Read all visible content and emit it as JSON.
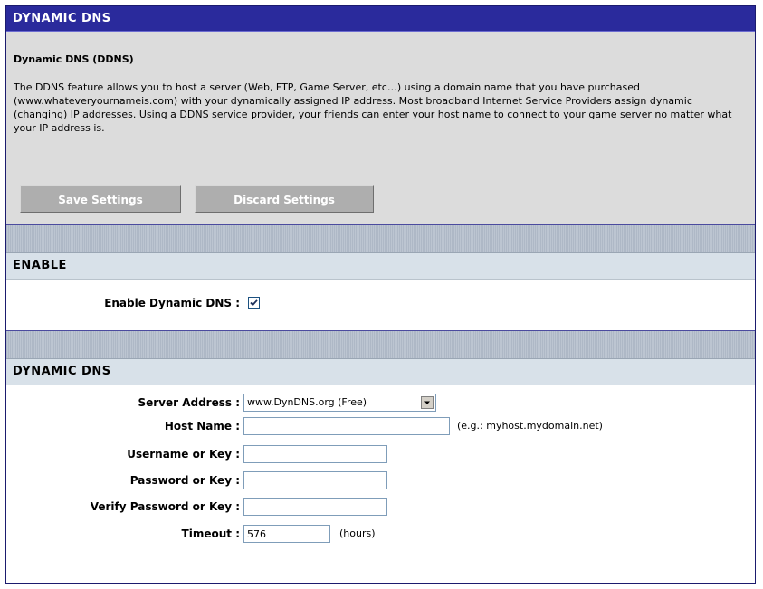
{
  "header": {
    "title": "DYNAMIC DNS"
  },
  "intro": {
    "title": "Dynamic DNS (DDNS)",
    "description": "The DDNS feature allows you to host a server (Web, FTP, Game Server, etc…) using a domain name that you have purchased (www.whateveryournameis.com) with your dynamically assigned IP address. Most broadband Internet Service Providers assign dynamic (changing) IP addresses. Using a DDNS service provider, your friends can enter your host name to connect to your game server no matter what your IP address is.",
    "save_label": "Save Settings",
    "discard_label": "Discard Settings"
  },
  "enable_section": {
    "title": "ENABLE",
    "enable_label": "Enable Dynamic DNS :",
    "enable_checked": true
  },
  "ddns_section": {
    "title": "DYNAMIC DNS",
    "server_label": "Server Address :",
    "server_value": "www.DynDNS.org (Free)",
    "host_label": "Host Name :",
    "host_value": "",
    "host_hint": "(e.g.: myhost.mydomain.net)",
    "username_label": "Username or Key :",
    "username_value": "",
    "password_label": "Password or Key :",
    "password_value": "",
    "verify_label": "Verify Password or Key :",
    "verify_value": "",
    "timeout_label": "Timeout :",
    "timeout_value": "576",
    "timeout_unit": "(hours)"
  }
}
